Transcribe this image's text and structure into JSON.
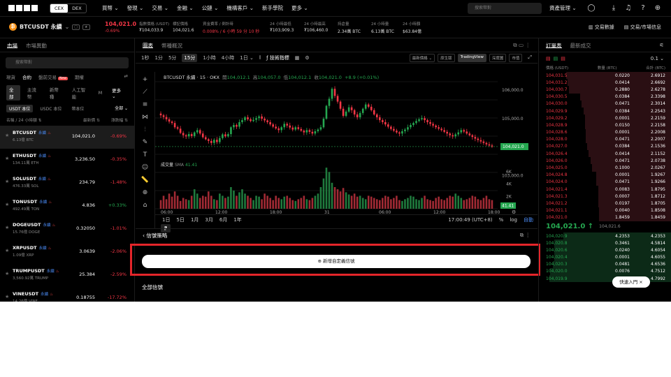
{
  "nav": {
    "cex": "CEX",
    "dex": "DEX",
    "menu": [
      "買幣 ⌄",
      "發現 ⌄",
      "交易 ⌄",
      "金融 ⌄",
      "公鏈 ⌄",
      "機構客戶 ⌄",
      "新手學院",
      "更多 ⌄"
    ],
    "search_placeholder": "搜索幣對",
    "assets": "資產管理 ⌄"
  },
  "ticker": {
    "symbol": "BTCUSDT 永續",
    "price": "104,021.0",
    "change": "-0.69%",
    "stats": [
      {
        "label": "指數價格 (USDT)",
        "value": "₮104,033.9"
      },
      {
        "label": "標記價格",
        "value": "104,021.6"
      },
      {
        "label": "資金費率 / 倒計時",
        "value": "0.008% / 6 小時 59 分 10 秒"
      },
      {
        "label": "24 小時最低",
        "value": "₮103,909.3"
      },
      {
        "label": "24 小時最高",
        "value": "₮106,460.0"
      },
      {
        "label": "持倉量",
        "value": "2.34萬 BTC"
      },
      {
        "label": "24 小時量",
        "value": "6.13萬 BTC"
      },
      {
        "label": "24 小時額",
        "value": "$63.84億"
      }
    ],
    "links": [
      "交易數據",
      "交易/市場信息"
    ]
  },
  "left": {
    "tabs": [
      "市場",
      "市場異動"
    ],
    "search_placeholder": "搜索幣對",
    "cats": [
      "現貨",
      "合約",
      "盤前交易",
      "期權"
    ],
    "new_badge": "New",
    "chips": [
      "全部",
      "主流幣",
      "新幣種",
      "人工智能",
      "M",
      "更多 ⌄"
    ],
    "chips2": [
      "USDT 本位",
      "USDC 本位",
      "幣本位"
    ],
    "all": "全部 ⌄",
    "col_name": "名稱 / 24 小時額 ⇅",
    "col_price": "最新價 ⇅",
    "col_change": "漲跌幅 ⇅",
    "markets": [
      {
        "name": "BTCUSDT",
        "tag": "永續",
        "vol": "6.13億 BTC",
        "price": "104,021.0",
        "change": "-0.69%",
        "up": false
      },
      {
        "name": "ETHUSDT",
        "tag": "永續",
        "vol": "134.11萬 ETH",
        "price": "3,236.50",
        "change": "-0.35%",
        "up": false
      },
      {
        "name": "SOLUSDT",
        "tag": "永續",
        "vol": "476.33萬 SOL",
        "price": "234.79",
        "change": "-1.48%",
        "up": false
      },
      {
        "name": "TONUSDT",
        "tag": "永續",
        "vol": "492.49萬 TON",
        "price": "4.836",
        "change": "+0.33%",
        "up": true
      },
      {
        "name": "DOGEUSDT",
        "tag": "永續",
        "vol": "15.76億 DOGE",
        "price": "0.32050",
        "change": "-1.01%",
        "up": false
      },
      {
        "name": "XRPUSDT",
        "tag": "永續",
        "vol": "1.09億 XRP",
        "price": "3.0639",
        "change": "-2.06%",
        "up": false
      },
      {
        "name": "TRUMPUSDT",
        "tag": "永續",
        "vol": "3,560.92萬 TRUMP",
        "price": "25.384",
        "change": "-2.59%",
        "up": false
      },
      {
        "name": "VINEUSDT",
        "tag": "永續",
        "vol": "14.26億 VINE",
        "price": "0.18755",
        "change": "-17.72%",
        "up": false
      }
    ]
  },
  "center": {
    "tabs": [
      "圖表",
      "幣種概況"
    ],
    "intervals": [
      "1秒",
      "1分",
      "5分",
      "15分",
      "1小時",
      "4小時",
      "1日 ⌄"
    ],
    "active_interval": "15分",
    "indicator": "技術指標",
    "tv_tabs": [
      "最新價格 ⌄",
      "原生版",
      "TradingView",
      "深度圖",
      "市值"
    ],
    "ohlc": {
      "title": "BTCUSDT 永續 · 15 · OKX",
      "o_lbl": "開",
      "o": "104,012.1",
      "h_lbl": "高",
      "h": "104,057.0",
      "l_lbl": "低",
      "l": "104,012.1",
      "c_lbl": "收",
      "c": "104,021.0",
      "chg": "+8.9 (+0.01%)"
    },
    "price_ticks": [
      "106,000.0",
      "105,000.0",
      "103,000.0"
    ],
    "last_tag": "104,021.0",
    "vol_label": "成交量",
    "vol_ind": "SMA",
    "vol_value": "41.41",
    "vol_ticks": [
      "6K",
      "4K",
      "2K"
    ],
    "vol_tag": "41.41",
    "time_ticks": [
      "06:00",
      "12:00",
      "18:00",
      "31",
      "06:00",
      "12:00",
      "18:00"
    ],
    "ranges": [
      "1日",
      "5日",
      "1月",
      "3月",
      "6月",
      "1年"
    ],
    "clock": "17:00:49 (UTC+8)",
    "pct": "%",
    "log": "log",
    "auto": "自動",
    "signal_title": "‹ 信號策略",
    "new_signal": "⊕ 新增自定義信號",
    "all_signals": "全部信號",
    "candles": [
      105180,
      105120,
      105060,
      104980,
      104900,
      104850,
      104700,
      104650,
      104500,
      104420,
      104380,
      104460,
      104390,
      104520,
      104600,
      104480,
      104350,
      104280,
      104220,
      104150,
      104260,
      104180,
      104320,
      104450,
      104380,
      104460,
      104700,
      104780,
      104720,
      104880,
      104950,
      105050,
      104980,
      104920,
      104960,
      105020,
      105080,
      105000,
      104940,
      104880,
      104800,
      104720,
      104660,
      104600,
      104700,
      104820,
      104760,
      104690,
      104620,
      104700,
      104640,
      104580,
      104520,
      104600,
      104540,
      104480,
      104560,
      104620,
      104700,
      105000,
      105450,
      105700,
      106050,
      105800,
      105600,
      105350,
      105100,
      105250,
      105400,
      105300,
      105150,
      105050,
      105200,
      105350,
      105500,
      105420,
      105300,
      105150,
      105050,
      104950,
      104880,
      104800,
      104720,
      104640,
      104580,
      104520,
      104480,
      104560,
      104620,
      104700,
      104780,
      104850,
      104920,
      104980,
      105020,
      104950,
      104880,
      104820,
      104760,
      104700,
      104650,
      104600,
      104540,
      104480,
      104420,
      104380,
      104450,
      104520,
      104600,
      104550,
      104480,
      104420,
      104360,
      104300,
      104250,
      104200,
      104150,
      104100,
      104060,
      104020
    ],
    "volumes": [
      0.25,
      0.2,
      0.3,
      0.22,
      0.35,
      0.28,
      0.4,
      0.3,
      0.18,
      0.25,
      0.22,
      0.2,
      0.3,
      0.45,
      0.35,
      0.25,
      0.3,
      0.28,
      0.4,
      0.3,
      0.22,
      0.2,
      0.35,
      0.3,
      0.25,
      0.28,
      0.5,
      0.42,
      0.3,
      0.38,
      0.45,
      0.35,
      0.3,
      0.25,
      0.2,
      0.3,
      0.28,
      0.22,
      0.35,
      0.3,
      0.25,
      0.2,
      0.3,
      0.25,
      0.22,
      0.28,
      0.3,
      0.25,
      0.2,
      0.18,
      0.22,
      0.25,
      0.3,
      0.22,
      0.2,
      0.25,
      0.3,
      0.35,
      0.5,
      0.7,
      0.95,
      0.85,
      0.6,
      0.5,
      0.45,
      0.4,
      0.48,
      0.38,
      0.33,
      0.3,
      0.35,
      0.28,
      0.3,
      0.25,
      0.22,
      0.3,
      0.28,
      0.25,
      0.22,
      0.2,
      0.25,
      0.3,
      0.28,
      0.22,
      0.25,
      0.3,
      0.2,
      0.18,
      0.22,
      0.25,
      0.3,
      0.28,
      0.22,
      0.2,
      0.25,
      0.3,
      0.22,
      0.2,
      0.18,
      0.25,
      0.28,
      0.22,
      0.2,
      0.25,
      0.3,
      0.28,
      0.35,
      0.3,
      0.25,
      0.2,
      0.22,
      0.25,
      0.3,
      0.28,
      0.22,
      0.2,
      0.25,
      0.3,
      0.22,
      0.2
    ]
  },
  "orderbook": {
    "tabs": [
      "訂單表",
      "最新成交"
    ],
    "step": "0.1 ⌄",
    "col_price": "價格 (USDT)",
    "col_qty": "數量 (BTC)",
    "col_total": "合計 (BTC)",
    "asks": [
      [
        "104,031.5",
        "0.0220",
        "2.6912"
      ],
      [
        "104,031.2",
        "0.0414",
        "2.6692"
      ],
      [
        "104,030.7",
        "0.2880",
        "2.6278"
      ],
      [
        "104,030.5",
        "0.0384",
        "2.3398"
      ],
      [
        "104,030.0",
        "0.0471",
        "2.3014"
      ],
      [
        "104,029.9",
        "0.0384",
        "2.2543"
      ],
      [
        "104,029.2",
        "0.0001",
        "2.2159"
      ],
      [
        "104,028.9",
        "0.0150",
        "2.2158"
      ],
      [
        "104,028.6",
        "0.0001",
        "2.2008"
      ],
      [
        "104,028.0",
        "0.0471",
        "2.2007"
      ],
      [
        "104,027.0",
        "0.0384",
        "2.1536"
      ],
      [
        "104,026.4",
        "0.0414",
        "2.1152"
      ],
      [
        "104,026.0",
        "0.0471",
        "2.0738"
      ],
      [
        "104,025.0",
        "0.1000",
        "2.0267"
      ],
      [
        "104,024.8",
        "0.0001",
        "1.9267"
      ],
      [
        "104,024.0",
        "0.0471",
        "1.9266"
      ],
      [
        "104,021.4",
        "0.0083",
        "1.8795"
      ],
      [
        "104,021.3",
        "0.0007",
        "1.8712"
      ],
      [
        "104,021.2",
        "0.0197",
        "1.8705"
      ],
      [
        "104,021.1",
        "0.0040",
        "1.8508"
      ],
      [
        "104,021.0",
        "1.8459",
        "1.8459"
      ]
    ],
    "mid_price": "104,021.0 ↑",
    "mid_mark": "104,021.6",
    "bids": [
      [
        "104,020.9",
        "4.2353",
        "4.2353"
      ],
      [
        "104,020.8",
        "0.3461",
        "4.5814"
      ],
      [
        "104,020.6",
        "0.0240",
        "4.6054"
      ],
      [
        "104,020.4",
        "0.0001",
        "4.6055"
      ],
      [
        "104,020.3",
        "0.0481",
        "4.6536"
      ],
      [
        "104,020.0",
        "0.0076",
        "4.7512"
      ],
      [
        "104,019.9",
        "0.0480",
        "4.7992"
      ]
    ],
    "quick": "快速入門  ×"
  },
  "colors": {
    "up": "#25a750",
    "down": "#f23645",
    "highlight": "#e4252a"
  }
}
